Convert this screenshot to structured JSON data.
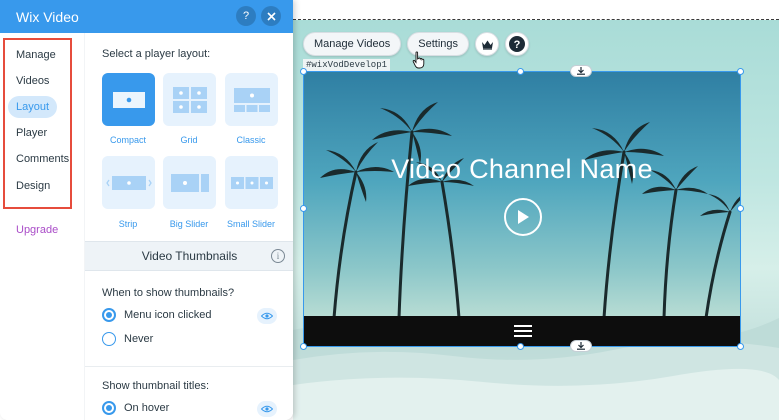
{
  "panel": {
    "title": "Wix Video",
    "help_icon": "question-icon",
    "close_icon": "close-icon",
    "accent": "#3899ec",
    "sidebar": {
      "items": [
        {
          "label": "Manage"
        },
        {
          "label": "Videos"
        },
        {
          "label": "Layout",
          "active": true
        },
        {
          "label": "Player"
        },
        {
          "label": "Comments"
        },
        {
          "label": "Design"
        }
      ],
      "upgrade_label": "Upgrade"
    },
    "layout": {
      "heading": "Select a player layout:",
      "options": [
        {
          "label": "Compact",
          "selected": true
        },
        {
          "label": "Grid"
        },
        {
          "label": "Classic"
        },
        {
          "label": "Strip"
        },
        {
          "label": "Big Slider"
        },
        {
          "label": "Small Slider"
        }
      ]
    },
    "thumbnails": {
      "section_title": "Video Thumbnails",
      "when_label": "When to show thumbnails?",
      "when_options": [
        {
          "label": "Menu icon clicked",
          "selected": true
        },
        {
          "label": "Never",
          "selected": false
        }
      ],
      "titles_label": "Show thumbnail titles:",
      "titles_options": [
        {
          "label": "On hover",
          "selected": true
        }
      ]
    }
  },
  "stage": {
    "toolbar": {
      "manage_videos_label": "Manage Videos",
      "settings_label": "Settings",
      "crown_icon": "crown-icon",
      "help_icon": "question-icon"
    },
    "component_id": "#wixVodDevelop1",
    "video": {
      "channel_name": "Video Channel Name",
      "play_icon": "play-icon",
      "menu_icon": "hamburger-menu-icon"
    }
  }
}
